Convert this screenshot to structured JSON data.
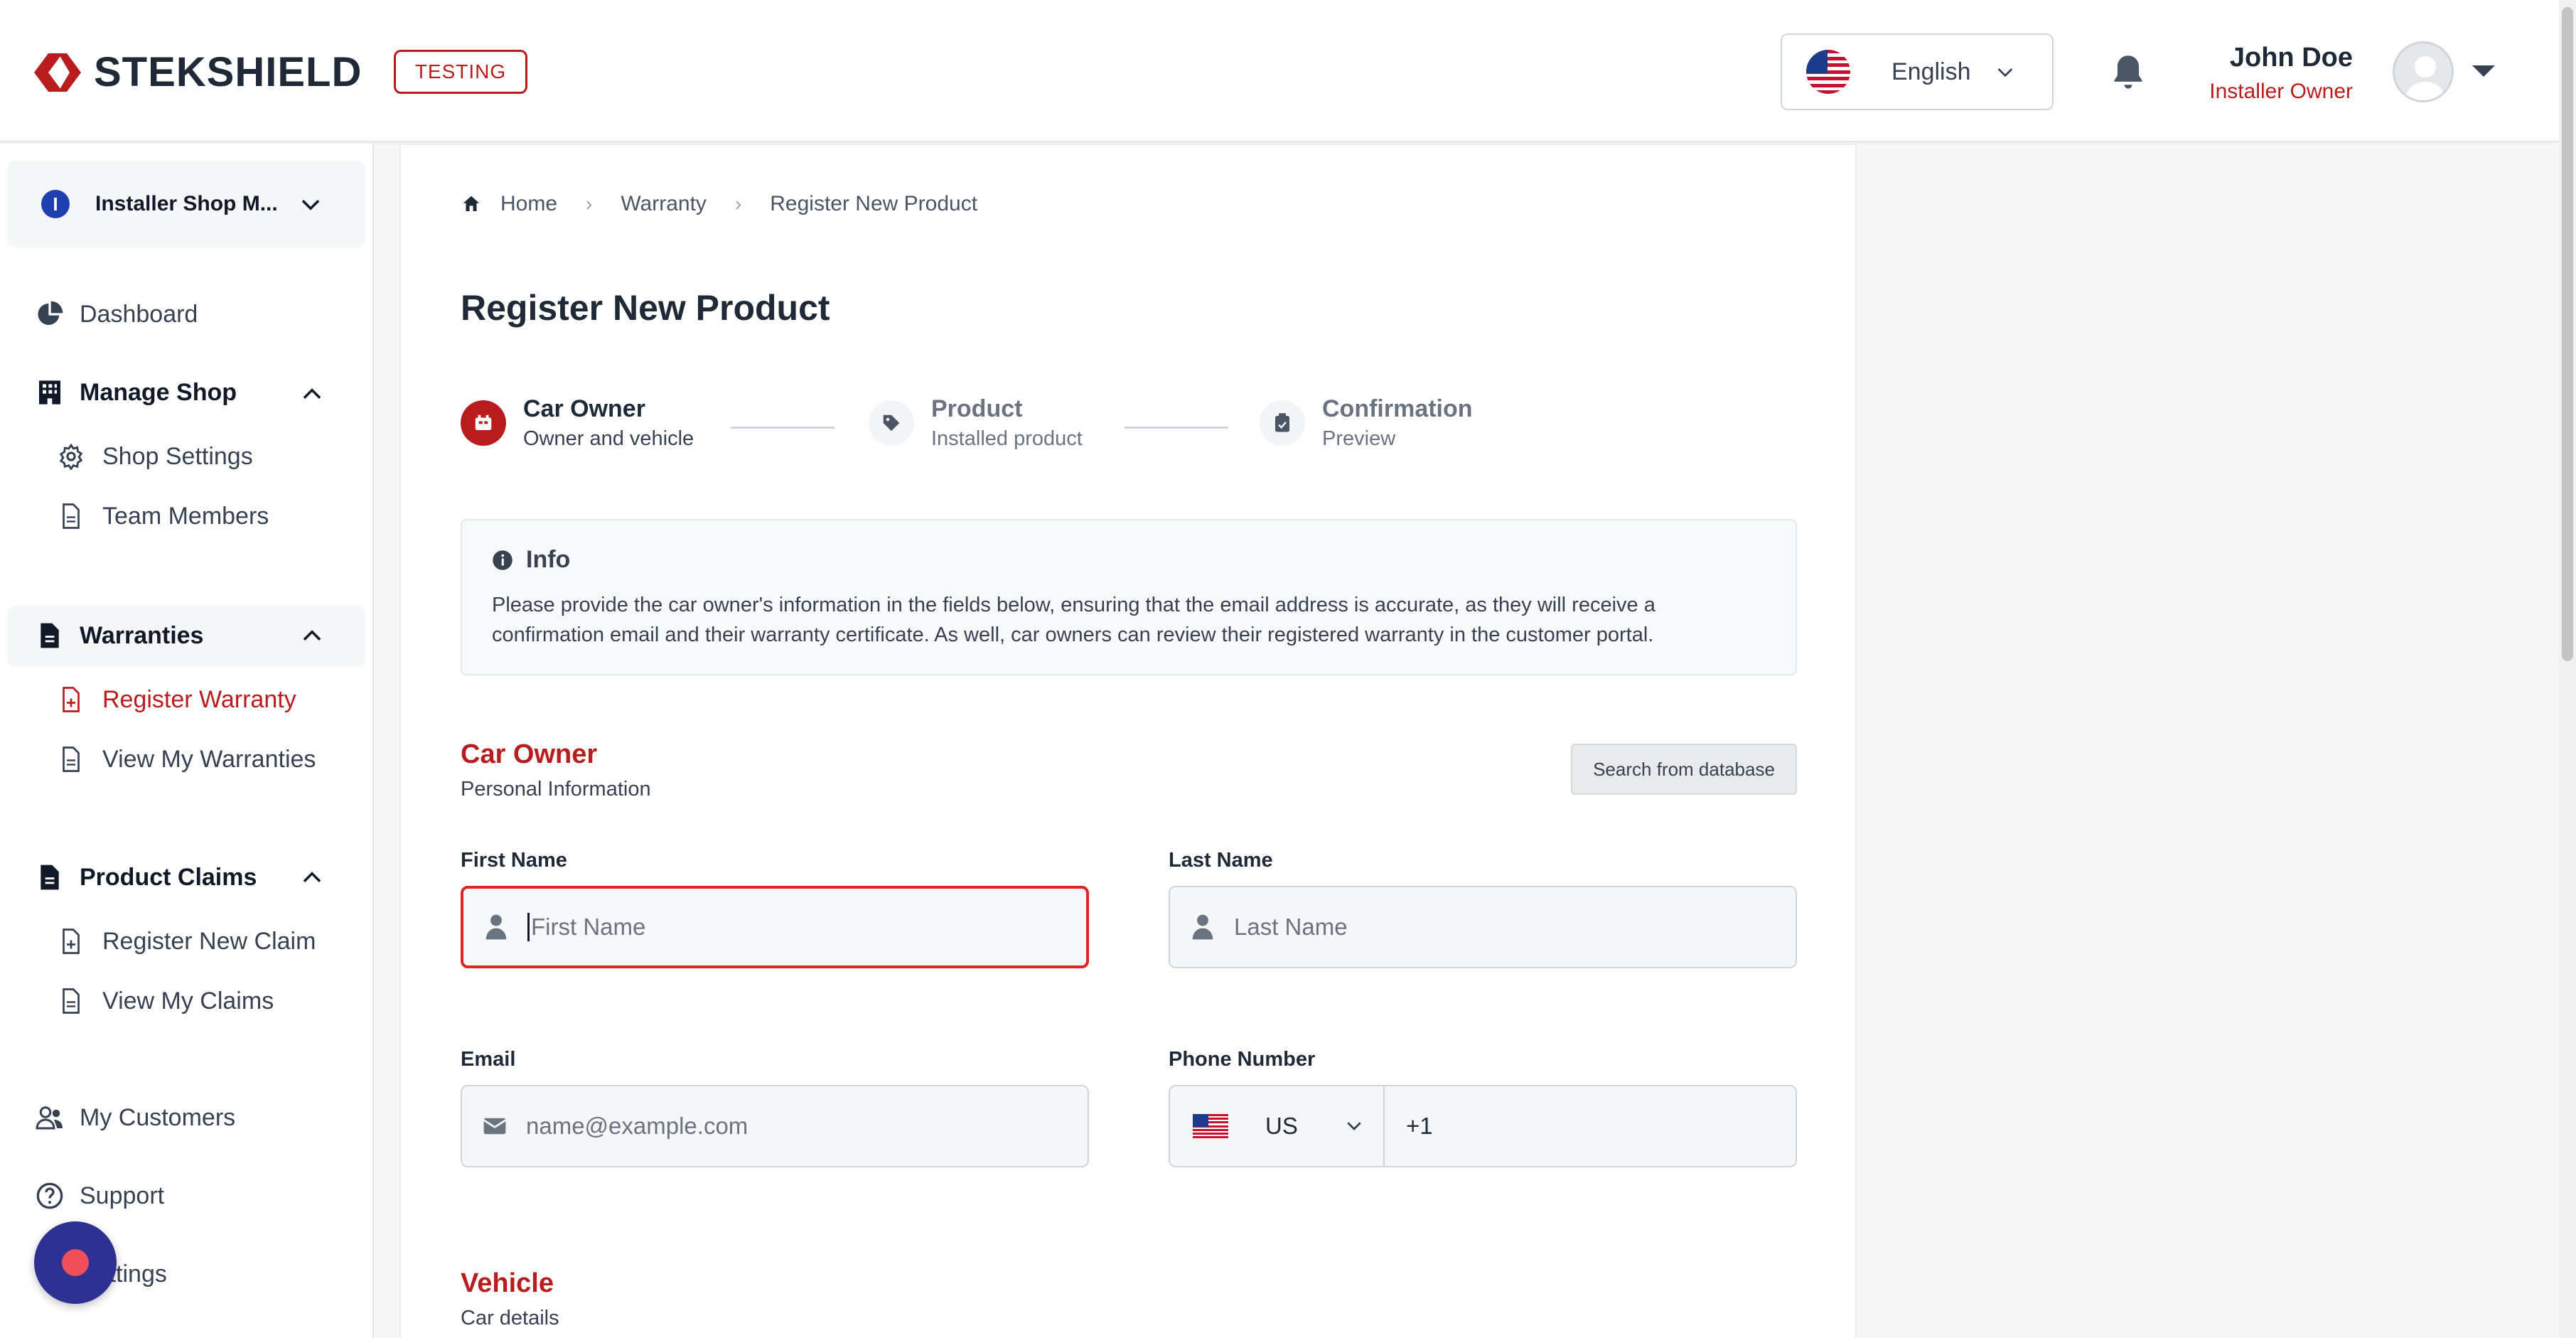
{
  "header": {
    "brand": "STEKSHIELD",
    "env_badge": "TESTING",
    "language": "English",
    "user_name": "John Doe",
    "user_role": "Installer Owner"
  },
  "sidebar": {
    "shop_initial": "I",
    "shop_name": "Installer Shop M...",
    "dashboard": "Dashboard",
    "manage_shop": "Manage Shop",
    "shop_settings": "Shop Settings",
    "team_members": "Team Members",
    "warranties": "Warranties",
    "register_warranty": "Register Warranty",
    "view_warranties": "View My Warranties",
    "product_claims": "Product Claims",
    "register_claim": "Register New Claim",
    "view_claims": "View My Claims",
    "my_customers": "My Customers",
    "support": "Support",
    "settings": "Settings"
  },
  "breadcrumb": [
    "Home",
    "Warranty",
    "Register New Product"
  ],
  "page_title": "Register New Product",
  "stepper": [
    {
      "title": "Car Owner",
      "subtitle": "Owner and vehicle",
      "state": "active"
    },
    {
      "title": "Product",
      "subtitle": "Installed product",
      "state": "inactive"
    },
    {
      "title": "Confirmation",
      "subtitle": "Preview",
      "state": "inactive"
    }
  ],
  "info": {
    "title": "Info",
    "text": "Please provide the car owner's information in the fields below, ensuring that the email address is accurate, as they will receive a confirmation email and their warranty certificate. As well, car owners can review their registered warranty in the customer portal."
  },
  "car_owner": {
    "title": "Car Owner",
    "subtitle": "Personal Information",
    "search_button": "Search from database",
    "first_name_label": "First Name",
    "first_name_placeholder": "First Name",
    "last_name_label": "Last Name",
    "last_name_placeholder": "Last Name",
    "email_label": "Email",
    "email_placeholder": "name@example.com",
    "phone_label": "Phone Number",
    "phone_country": "US",
    "phone_code": "+1"
  },
  "vehicle": {
    "title": "Vehicle",
    "subtitle": "Car details"
  },
  "colors": {
    "accent": "#b91c1c",
    "fab": "#2e3192",
    "shop_dot": "#1e40af"
  }
}
